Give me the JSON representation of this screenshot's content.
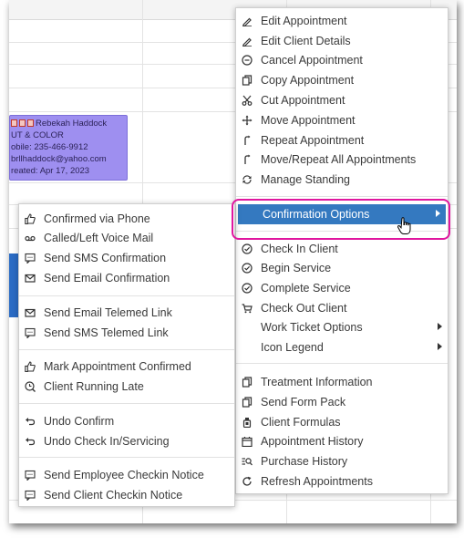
{
  "appointment": {
    "line1": "Rebekah Haddock",
    "line2": "UT & COLOR",
    "line3": "obile: 235-466-9912",
    "line4": "brllhaddock@yahoo.com",
    "line5": "reated: Apr 17, 2023",
    "color": "#9e8ff0"
  },
  "context_menu": {
    "items": [
      {
        "label": "Edit Appointment",
        "icon": "pencil-icon"
      },
      {
        "label": "Edit Client Details",
        "icon": "pencil-icon"
      },
      {
        "label": "Cancel Appointment",
        "icon": "minus-circle-icon"
      },
      {
        "label": "Copy Appointment",
        "icon": "copy-icon"
      },
      {
        "label": "Cut Appointment",
        "icon": "scissors-icon"
      },
      {
        "label": "Move Appointment",
        "icon": "move-icon"
      },
      {
        "label": "Repeat Appointment",
        "icon": "repeat-icon"
      },
      {
        "label": "Move/Repeat All Appointments",
        "icon": "repeat-icon"
      },
      {
        "label": "Manage Standing",
        "icon": "refresh-icon"
      },
      {
        "label": "Confirmation Options",
        "icon": "",
        "submenu": true,
        "active": true
      },
      {
        "label": "Check In Client",
        "icon": "check-circle-icon"
      },
      {
        "label": "Begin Service",
        "icon": "check-circle-icon"
      },
      {
        "label": "Complete Service",
        "icon": "check-circle-icon"
      },
      {
        "label": "Check Out Client",
        "icon": "cart-icon"
      },
      {
        "label": "Work Ticket Options",
        "icon": "",
        "submenu": true
      },
      {
        "label": "Icon Legend",
        "icon": "",
        "submenu": true
      },
      {
        "label": "Treatment Information",
        "icon": "copy-icon"
      },
      {
        "label": "Send Form Pack",
        "icon": "copy-icon"
      },
      {
        "label": "Client Formulas",
        "icon": "bottle-icon"
      },
      {
        "label": "Appointment History",
        "icon": "calendar-icon"
      },
      {
        "label": "Purchase History",
        "icon": "list-search-icon"
      },
      {
        "label": "Refresh Appointments",
        "icon": "reload-icon"
      }
    ]
  },
  "confirmation_submenu": {
    "items": [
      {
        "label": "Confirmed via Phone",
        "icon": "thumbs-up-icon"
      },
      {
        "label": "Called/Left Voice Mail",
        "icon": "voicemail-icon"
      },
      {
        "label": "Send SMS Confirmation",
        "icon": "chat-icon"
      },
      {
        "label": "Send Email Confirmation",
        "icon": "envelope-icon"
      },
      {
        "label": "Send Email Telemed Link",
        "icon": "envelope-icon"
      },
      {
        "label": "Send SMS Telemed Link",
        "icon": "chat-icon"
      },
      {
        "label": "Mark Appointment Confirmed",
        "icon": "thumbs-up-icon"
      },
      {
        "label": "Client Running Late",
        "icon": "clock-search-icon"
      },
      {
        "label": "Undo Confirm",
        "icon": "undo-icon"
      },
      {
        "label": "Undo Check In/Servicing",
        "icon": "undo-icon"
      },
      {
        "label": "Send Employee Checkin Notice",
        "icon": "chat-icon"
      },
      {
        "label": "Send Client Checkin Notice",
        "icon": "chat-icon"
      }
    ]
  },
  "colors": {
    "active_item": "#3479c0",
    "highlight_border": "#e0169f"
  }
}
